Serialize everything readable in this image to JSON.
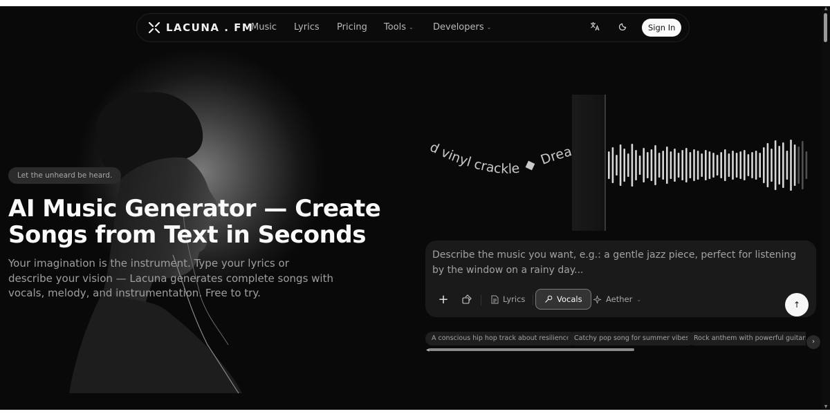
{
  "nav": {
    "brand": "LACUNA . FM",
    "links": [
      "Music",
      "Lyrics",
      "Pricing",
      "Tools",
      "Developers"
    ],
    "signin_label": "Sign In"
  },
  "hero": {
    "badge": "Let the unheard be heard.",
    "headline_line1": "AI Music Generator — Create",
    "headline_line2": "Songs from Text in Seconds",
    "subline": "Your imagination is the instrument. Type your lyrics or describe your vision — Lacuna generates complete songs with vocals, melody, and instrumentation. Free to try."
  },
  "visual": {
    "curved_text": "d vinyl crackle",
    "curved_text_2": "Dreamy syn"
  },
  "prompt": {
    "placeholder": "Describe the music you want, e.g.: a gentle jazz piece, perfect for listening by the window on a rainy day...",
    "tools": {
      "lyrics": "Lyrics",
      "vocals": "Vocals",
      "model": "Aether"
    }
  },
  "suggestions": [
    "A conscious hip hop track about resilience",
    "Catchy pop song for summer vibes",
    "Rock anthem with powerful guitars"
  ],
  "icons": {
    "logo": "lacuna-logo-icon",
    "translate": "translate-icon",
    "theme": "moon-icon",
    "add": "plus-icon",
    "attach": "attach-icon",
    "lyrics": "document-icon",
    "vocals": "microphone-icon",
    "model": "sparkle-icon",
    "send": "arrow-up-icon",
    "next": "chevron-right-icon"
  },
  "colors": {
    "background": "#090909",
    "panel": "#1a1a1a",
    "accent": "#fafafa"
  }
}
